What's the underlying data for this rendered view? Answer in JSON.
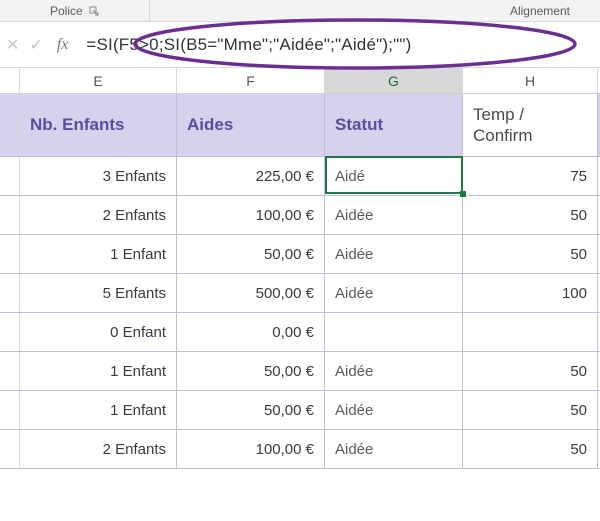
{
  "ribbon": {
    "group_font_label": "Police",
    "group_align_label": "Alignement"
  },
  "formula_bar": {
    "cancel_glyph": "✕",
    "confirm_glyph": "✓",
    "fx_label": "fx",
    "formula": "=SI(F5>0;SI(B5=\"Mme\";\"Aidée\";\"Aidé\");\"\")"
  },
  "column_headers": {
    "e": "E",
    "f": "F",
    "g": "G",
    "h": "H"
  },
  "table": {
    "headers": {
      "e": "Nb. Enfants",
      "f": "Aides",
      "g": "Statut",
      "h": "Temp / Confirm"
    },
    "rows": [
      {
        "e": "3 Enfants",
        "f": "225,00 €",
        "g": "Aidé",
        "h": "75"
      },
      {
        "e": "2 Enfants",
        "f": "100,00 €",
        "g": "Aidée",
        "h": "50"
      },
      {
        "e": "1 Enfant",
        "f": "50,00 €",
        "g": "Aidée",
        "h": "50"
      },
      {
        "e": "5 Enfants",
        "f": "500,00 €",
        "g": "Aidée",
        "h": "100"
      },
      {
        "e": "0 Enfant",
        "f": "0,00 €",
        "g": "",
        "h": ""
      },
      {
        "e": "1 Enfant",
        "f": "50,00 €",
        "g": "Aidée",
        "h": "50"
      },
      {
        "e": "1 Enfant",
        "f": "50,00 €",
        "g": "Aidée",
        "h": "50"
      },
      {
        "e": "2 Enfants",
        "f": "100,00 €",
        "g": "Aidée",
        "h": "50"
      }
    ]
  },
  "chart_data": {
    "type": "table",
    "title": "",
    "columns": [
      "Nb. Enfants",
      "Aides",
      "Statut",
      "Temp / Confirm"
    ],
    "rows": [
      [
        "3 Enfants",
        "225,00 €",
        "Aidé",
        75
      ],
      [
        "2 Enfants",
        "100,00 €",
        "Aidée",
        50
      ],
      [
        "1 Enfant",
        "50,00 €",
        "Aidée",
        50
      ],
      [
        "5 Enfants",
        "500,00 €",
        "Aidée",
        100
      ],
      [
        "0 Enfant",
        "0,00 €",
        "",
        null
      ],
      [
        "1 Enfant",
        "50,00 €",
        "Aidée",
        50
      ],
      [
        "1 Enfant",
        "50,00 €",
        "Aidée",
        50
      ],
      [
        "2 Enfants",
        "100,00 €",
        "Aidée",
        50
      ]
    ]
  },
  "active_cell": {
    "col": "G",
    "row_index": 0
  }
}
